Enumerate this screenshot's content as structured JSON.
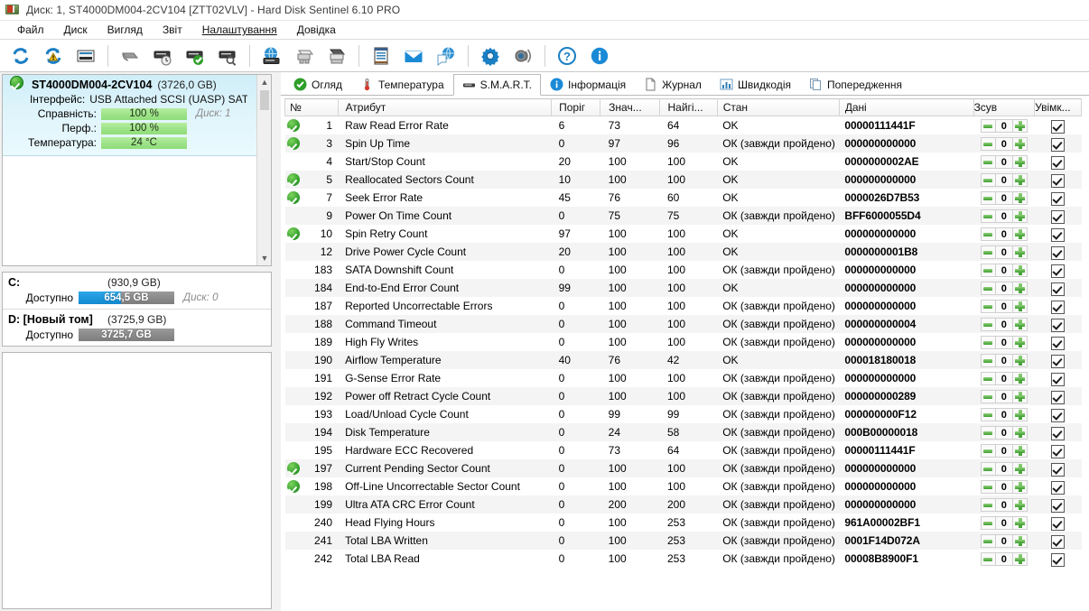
{
  "window": {
    "title": "Диск: 1, ST4000DM004-2CV104 [ZTT02VLV]  -  Hard Disk Sentinel 6.10 PRO",
    "icon": "hard-disk-icon"
  },
  "menu": {
    "items": [
      {
        "label": "Файл"
      },
      {
        "label": "Диск"
      },
      {
        "label": "Вигляд"
      },
      {
        "label": "Звіт"
      },
      {
        "label": "Налаштування"
      },
      {
        "label": "Довідка"
      }
    ]
  },
  "toolbar": {
    "buttons": [
      {
        "name": "refresh-icon"
      },
      {
        "name": "refresh-alert-icon"
      },
      {
        "name": "disk-list-icon"
      },
      {
        "name": "sep"
      },
      {
        "name": "disk-sleep-icon"
      },
      {
        "name": "disk-clock-icon"
      },
      {
        "name": "disk-ok-icon"
      },
      {
        "name": "disk-search-icon"
      },
      {
        "name": "sep"
      },
      {
        "name": "network-disk-icon"
      },
      {
        "name": "remote-disk-icon"
      },
      {
        "name": "server-disk-icon"
      },
      {
        "name": "sep"
      },
      {
        "name": "report-icon"
      },
      {
        "name": "email-icon"
      },
      {
        "name": "send-report-icon"
      },
      {
        "name": "sep"
      },
      {
        "name": "settings-gear-icon"
      },
      {
        "name": "alert-sound-icon"
      },
      {
        "name": "sep"
      },
      {
        "name": "help-icon"
      },
      {
        "name": "info-icon"
      }
    ]
  },
  "left": {
    "disk": {
      "model": "ST4000DM004-2CV104",
      "capacity": "(3726,0 GB)",
      "interface_label": "Інтерфейс:",
      "interface_value": "USB Attached SCSI (UASP) SAT Star",
      "health_label": "Справність:",
      "health_value": "100 %",
      "perf_label": "Перф.:",
      "perf_value": "100 %",
      "temp_label": "Температура:",
      "temp_value": "24 °C",
      "disk_index": "Диск: 1",
      "status_icon": "ok-check-icon"
    },
    "volumes": [
      {
        "name": "C:",
        "capacity": "(930,9 GB)",
        "available_label": "Доступно",
        "available_value": "654,5 GB",
        "fill_percent": 44,
        "disk_index": "Диск: 0"
      },
      {
        "name": "D: [Новый том]",
        "capacity": "(3725,9 GB)",
        "available_label": "Доступно",
        "available_value": "3725,7 GB",
        "fill_percent": 0,
        "disk_index": ""
      }
    ]
  },
  "tabs": [
    {
      "label": "Огляд",
      "icon": "overview-check-icon",
      "active": false
    },
    {
      "label": "Температура",
      "icon": "thermometer-icon",
      "active": false
    },
    {
      "label": "S.M.A.R.T.",
      "icon": "smart-chip-icon",
      "active": true
    },
    {
      "label": "Інформація",
      "icon": "info-circle-icon",
      "active": false
    },
    {
      "label": "Журнал",
      "icon": "log-page-icon",
      "active": false
    },
    {
      "label": "Швидкодія",
      "icon": "performance-chart-icon",
      "active": false
    },
    {
      "label": "Попередження",
      "icon": "warning-copy-icon",
      "active": false
    }
  ],
  "table": {
    "columns": [
      "№",
      "Атрибут",
      "Поріг",
      "Знач...",
      "Найгі...",
      "Стан",
      "Дані",
      "Зсув",
      "Увімк..."
    ],
    "rows": [
      {
        "check": true,
        "id": "1",
        "attr": "Raw Read Error Rate",
        "thr": "6",
        "val": "73",
        "worst": "64",
        "state": "OK",
        "data": "00000111441F",
        "offset": "0",
        "enabled": true
      },
      {
        "check": true,
        "id": "3",
        "attr": "Spin Up Time",
        "thr": "0",
        "val": "97",
        "worst": "96",
        "state": "ОК (завжди пройдено)",
        "data": "000000000000",
        "offset": "0",
        "enabled": true
      },
      {
        "check": false,
        "id": "4",
        "attr": "Start/Stop Count",
        "thr": "20",
        "val": "100",
        "worst": "100",
        "state": "OK",
        "data": "0000000002AE",
        "offset": "0",
        "enabled": true
      },
      {
        "check": true,
        "id": "5",
        "attr": "Reallocated Sectors Count",
        "thr": "10",
        "val": "100",
        "worst": "100",
        "state": "OK",
        "data": "000000000000",
        "offset": "0",
        "enabled": true
      },
      {
        "check": true,
        "id": "7",
        "attr": "Seek Error Rate",
        "thr": "45",
        "val": "76",
        "worst": "60",
        "state": "OK",
        "data": "0000026D7B53",
        "offset": "0",
        "enabled": true
      },
      {
        "check": false,
        "id": "9",
        "attr": "Power On Time Count",
        "thr": "0",
        "val": "75",
        "worst": "75",
        "state": "ОК (завжди пройдено)",
        "data": "BFF6000055D4",
        "offset": "0",
        "enabled": true
      },
      {
        "check": true,
        "id": "10",
        "attr": "Spin Retry Count",
        "thr": "97",
        "val": "100",
        "worst": "100",
        "state": "OK",
        "data": "000000000000",
        "offset": "0",
        "enabled": true
      },
      {
        "check": false,
        "id": "12",
        "attr": "Drive Power Cycle Count",
        "thr": "20",
        "val": "100",
        "worst": "100",
        "state": "OK",
        "data": "0000000001B8",
        "offset": "0",
        "enabled": true
      },
      {
        "check": false,
        "id": "183",
        "attr": "SATA Downshift Count",
        "thr": "0",
        "val": "100",
        "worst": "100",
        "state": "ОК (завжди пройдено)",
        "data": "000000000000",
        "offset": "0",
        "enabled": true
      },
      {
        "check": false,
        "id": "184",
        "attr": "End-to-End Error Count",
        "thr": "99",
        "val": "100",
        "worst": "100",
        "state": "OK",
        "data": "000000000000",
        "offset": "0",
        "enabled": true
      },
      {
        "check": false,
        "id": "187",
        "attr": "Reported Uncorrectable Errors",
        "thr": "0",
        "val": "100",
        "worst": "100",
        "state": "ОК (завжди пройдено)",
        "data": "000000000000",
        "offset": "0",
        "enabled": true
      },
      {
        "check": false,
        "id": "188",
        "attr": "Command Timeout",
        "thr": "0",
        "val": "100",
        "worst": "100",
        "state": "ОК (завжди пройдено)",
        "data": "000000000004",
        "offset": "0",
        "enabled": true
      },
      {
        "check": false,
        "id": "189",
        "attr": "High Fly Writes",
        "thr": "0",
        "val": "100",
        "worst": "100",
        "state": "ОК (завжди пройдено)",
        "data": "000000000000",
        "offset": "0",
        "enabled": true
      },
      {
        "check": false,
        "id": "190",
        "attr": "Airflow Temperature",
        "thr": "40",
        "val": "76",
        "worst": "42",
        "state": "OK",
        "data": "000018180018",
        "offset": "0",
        "enabled": true
      },
      {
        "check": false,
        "id": "191",
        "attr": "G-Sense Error Rate",
        "thr": "0",
        "val": "100",
        "worst": "100",
        "state": "ОК (завжди пройдено)",
        "data": "000000000000",
        "offset": "0",
        "enabled": true
      },
      {
        "check": false,
        "id": "192",
        "attr": "Power off Retract Cycle Count",
        "thr": "0",
        "val": "100",
        "worst": "100",
        "state": "ОК (завжди пройдено)",
        "data": "000000000289",
        "offset": "0",
        "enabled": true
      },
      {
        "check": false,
        "id": "193",
        "attr": "Load/Unload Cycle Count",
        "thr": "0",
        "val": "99",
        "worst": "99",
        "state": "ОК (завжди пройдено)",
        "data": "000000000F12",
        "offset": "0",
        "enabled": true
      },
      {
        "check": false,
        "id": "194",
        "attr": "Disk Temperature",
        "thr": "0",
        "val": "24",
        "worst": "58",
        "state": "ОК (завжди пройдено)",
        "data": "000B00000018",
        "offset": "0",
        "enabled": true
      },
      {
        "check": false,
        "id": "195",
        "attr": "Hardware ECC Recovered",
        "thr": "0",
        "val": "73",
        "worst": "64",
        "state": "ОК (завжди пройдено)",
        "data": "00000111441F",
        "offset": "0",
        "enabled": true
      },
      {
        "check": true,
        "id": "197",
        "attr": "Current Pending Sector Count",
        "thr": "0",
        "val": "100",
        "worst": "100",
        "state": "ОК (завжди пройдено)",
        "data": "000000000000",
        "offset": "0",
        "enabled": true
      },
      {
        "check": true,
        "id": "198",
        "attr": "Off-Line Uncorrectable Sector Count",
        "thr": "0",
        "val": "100",
        "worst": "100",
        "state": "ОК (завжди пройдено)",
        "data": "000000000000",
        "offset": "0",
        "enabled": true
      },
      {
        "check": false,
        "id": "199",
        "attr": "Ultra ATA CRC Error Count",
        "thr": "0",
        "val": "200",
        "worst": "200",
        "state": "ОК (завжди пройдено)",
        "data": "000000000000",
        "offset": "0",
        "enabled": true
      },
      {
        "check": false,
        "id": "240",
        "attr": "Head Flying Hours",
        "thr": "0",
        "val": "100",
        "worst": "253",
        "state": "ОК (завжди пройдено)",
        "data": "961A00002BF1",
        "offset": "0",
        "enabled": true
      },
      {
        "check": false,
        "id": "241",
        "attr": "Total LBA Written",
        "thr": "0",
        "val": "100",
        "worst": "253",
        "state": "ОК (завжди пройдено)",
        "data": "0001F14D072A",
        "offset": "0",
        "enabled": true
      },
      {
        "check": false,
        "id": "242",
        "attr": "Total LBA Read",
        "thr": "0",
        "val": "100",
        "worst": "253",
        "state": "ОК (завжди пройдено)",
        "data": "00008B8900F1",
        "offset": "0",
        "enabled": true
      }
    ]
  },
  "colors": {
    "accent_blue": "#1389cf",
    "ok_green": "#2f9e2a",
    "bar_green": "#9ee389",
    "selection_cyan": "#cfeef8"
  }
}
